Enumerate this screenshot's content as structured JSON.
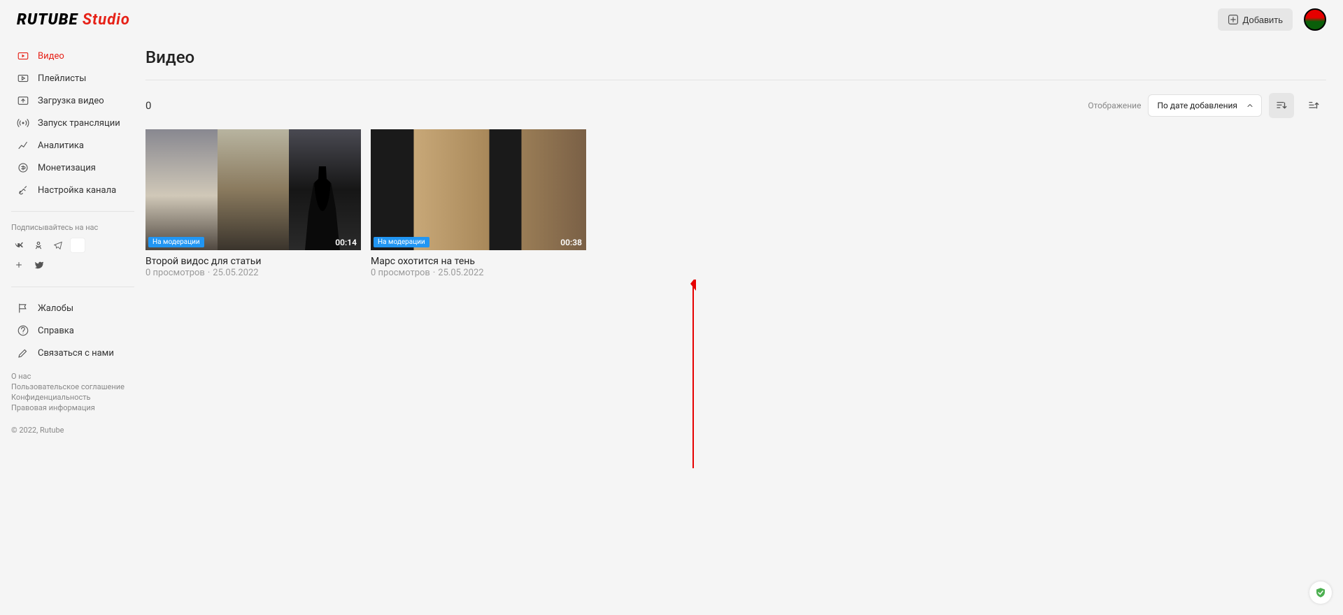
{
  "header": {
    "logo_main": "RUTUBE",
    "logo_studio": "Studio",
    "add_label": "Добавить"
  },
  "sidebar": {
    "items": [
      {
        "label": "Видео"
      },
      {
        "label": "Плейлисты"
      },
      {
        "label": "Загрузка видео"
      },
      {
        "label": "Запуск трансляции"
      },
      {
        "label": "Аналитика"
      },
      {
        "label": "Монетизация"
      },
      {
        "label": "Настройка канала"
      }
    ],
    "subscribe_label": "Подписывайтесь на нас",
    "help_items": [
      {
        "label": "Жалобы"
      },
      {
        "label": "Справка"
      },
      {
        "label": "Связаться с нами"
      }
    ],
    "footer_links": [
      "О нас",
      "Пользовательское соглашение",
      "Конфиденциальность",
      "Правовая информация"
    ],
    "copyright": "© 2022, Rutube"
  },
  "main": {
    "title": "Видео",
    "count": "0",
    "display_label": "Отображение",
    "sort_label": "По дате добавления",
    "videos": [
      {
        "badge": "На модерации",
        "duration": "00:14",
        "title": "Второй видос для статьи",
        "views": "0 просмотров",
        "date": "25.05.2022"
      },
      {
        "badge": "На модерации",
        "duration": "00:38",
        "title": "Марс охотится на тень",
        "views": "0 просмотров",
        "date": "25.05.2022"
      }
    ]
  }
}
